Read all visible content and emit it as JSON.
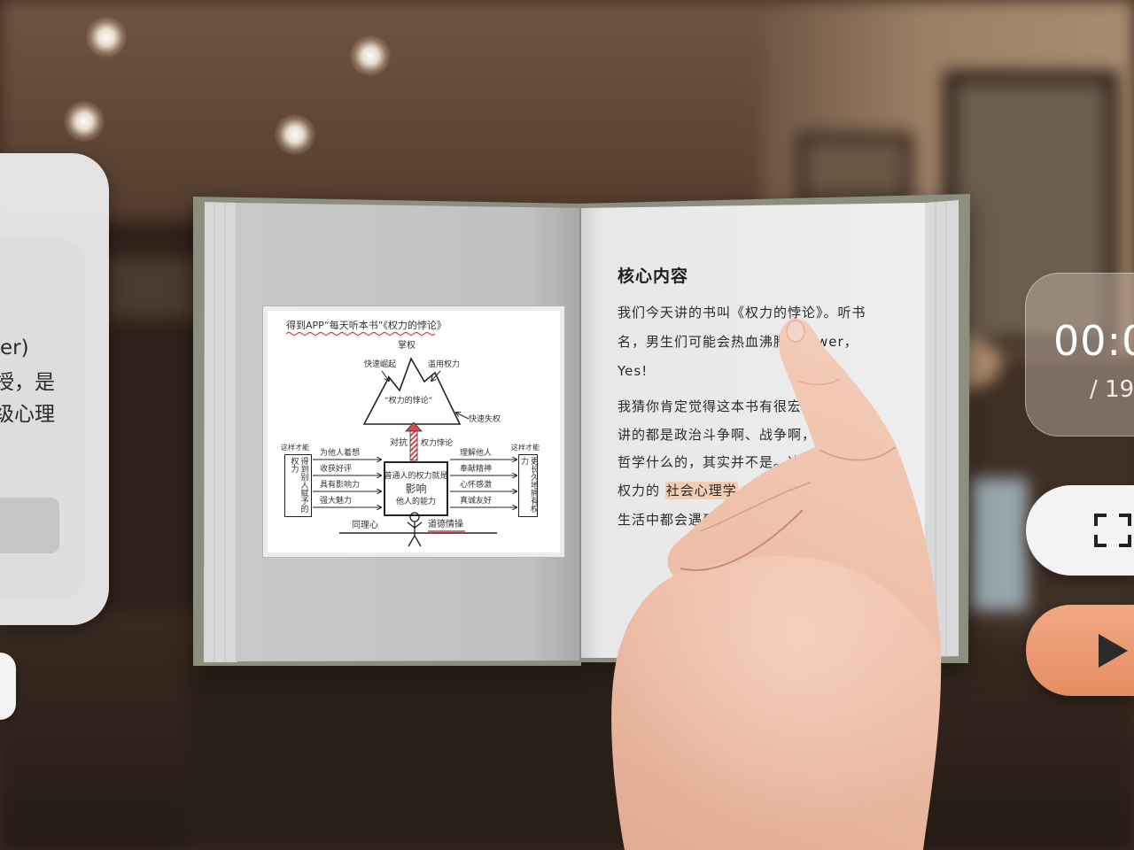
{
  "book": {
    "sketch": {
      "title": "得到APP“每天听本书”《权力的悖论》",
      "peak": "掌权",
      "rise": "快速崛起",
      "abuse": "滥用权力",
      "paradox": "“权力的悖论”",
      "fall": "快速失权",
      "counter_left": "对抗",
      "counter_right": "权力悖论",
      "center_lines": [
        "普通人的权力就是",
        "影响",
        "他人的能力"
      ],
      "left_header": "这样才能",
      "left_box": "得到别人赋予的权力",
      "left_labels": [
        "为他人着想",
        "收获好评",
        "具有影响力",
        "强大魅力"
      ],
      "right_header": "这样才能",
      "right_box": "更长久地拥有权力",
      "right_labels": [
        "理解他人",
        "奉献精神",
        "心怀感激",
        "真诚友好"
      ],
      "bottom_left": "同理心",
      "bottom_right": "道德情操"
    },
    "right_page": {
      "heading": "核心内容",
      "lines": [
        "我们今天讲的书叫《权力的悖论》。听书",
        "名，男生们可能会热血沸腾",
        "Yes!",
        "我猜你肯定觉得这本书有很宏大",
        "讲的都是政治斗争啊、战争啊，",
        "哲学什么的，其实并不是。这",
        "权力的",
        "生活中都会遇到权"
      ],
      "line1_tail": "wer，",
      "highlight": "社会心理学"
    }
  },
  "left_panel": {
    "lines": [
      "er)",
      "授，是",
      "级心理"
    ]
  },
  "player": {
    "time": "00:0",
    "duration": "/ 19"
  },
  "icons": {
    "fullscreen": "fullscreen-icon",
    "play": "play-icon"
  },
  "colors": {
    "play_button": "#e98f66",
    "highlight": "#f3ccb4",
    "book_cover": "#8c8f7e"
  }
}
